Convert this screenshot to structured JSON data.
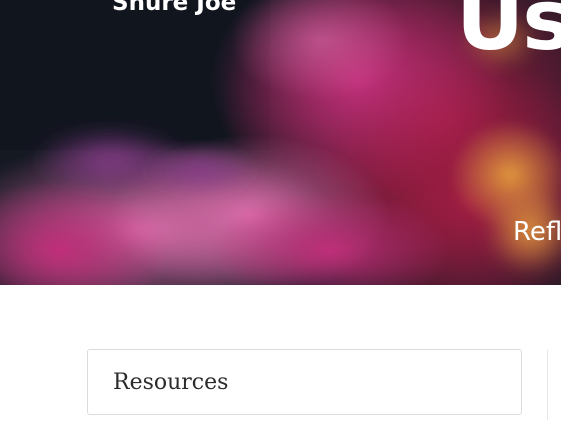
{
  "header": {
    "site_name": "Shure Joe",
    "title": "Us",
    "subtitle": "Refl"
  },
  "main": {
    "resources_heading": "Resources"
  },
  "colors": {
    "hero_dark": "#161a24",
    "smoke_magenta": "#b6347a",
    "smoke_pink": "#d95aa0",
    "smoke_orange": "#d98a3a",
    "text_white": "#ffffff",
    "card_border": "#dcdcdc",
    "heading_text": "#2b2b2b"
  }
}
